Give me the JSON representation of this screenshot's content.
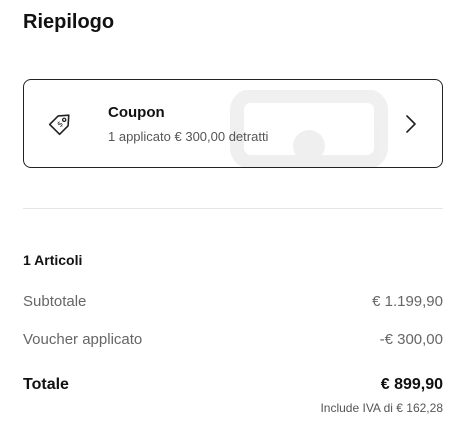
{
  "summary": {
    "title": "Riepilogo"
  },
  "coupon": {
    "title": "Coupon",
    "subtitle": "1 applicato € 300,00 detratti",
    "icon": "tag-icon",
    "chevron": "chevron-right-icon"
  },
  "items": {
    "count_label": "1 Articoli"
  },
  "rows": {
    "subtotal": {
      "label": "Subtotale",
      "value": "€ 1.199,90"
    },
    "voucher": {
      "label": "Voucher applicato",
      "value": "-€ 300,00"
    }
  },
  "total": {
    "label": "Totale",
    "value": "€ 899,90",
    "vat_note": "Include IVA di € 162,28"
  },
  "colors": {
    "text_primary": "#111111",
    "text_secondary": "#666666",
    "border": "#222222",
    "divider": "#e6e6e6"
  }
}
